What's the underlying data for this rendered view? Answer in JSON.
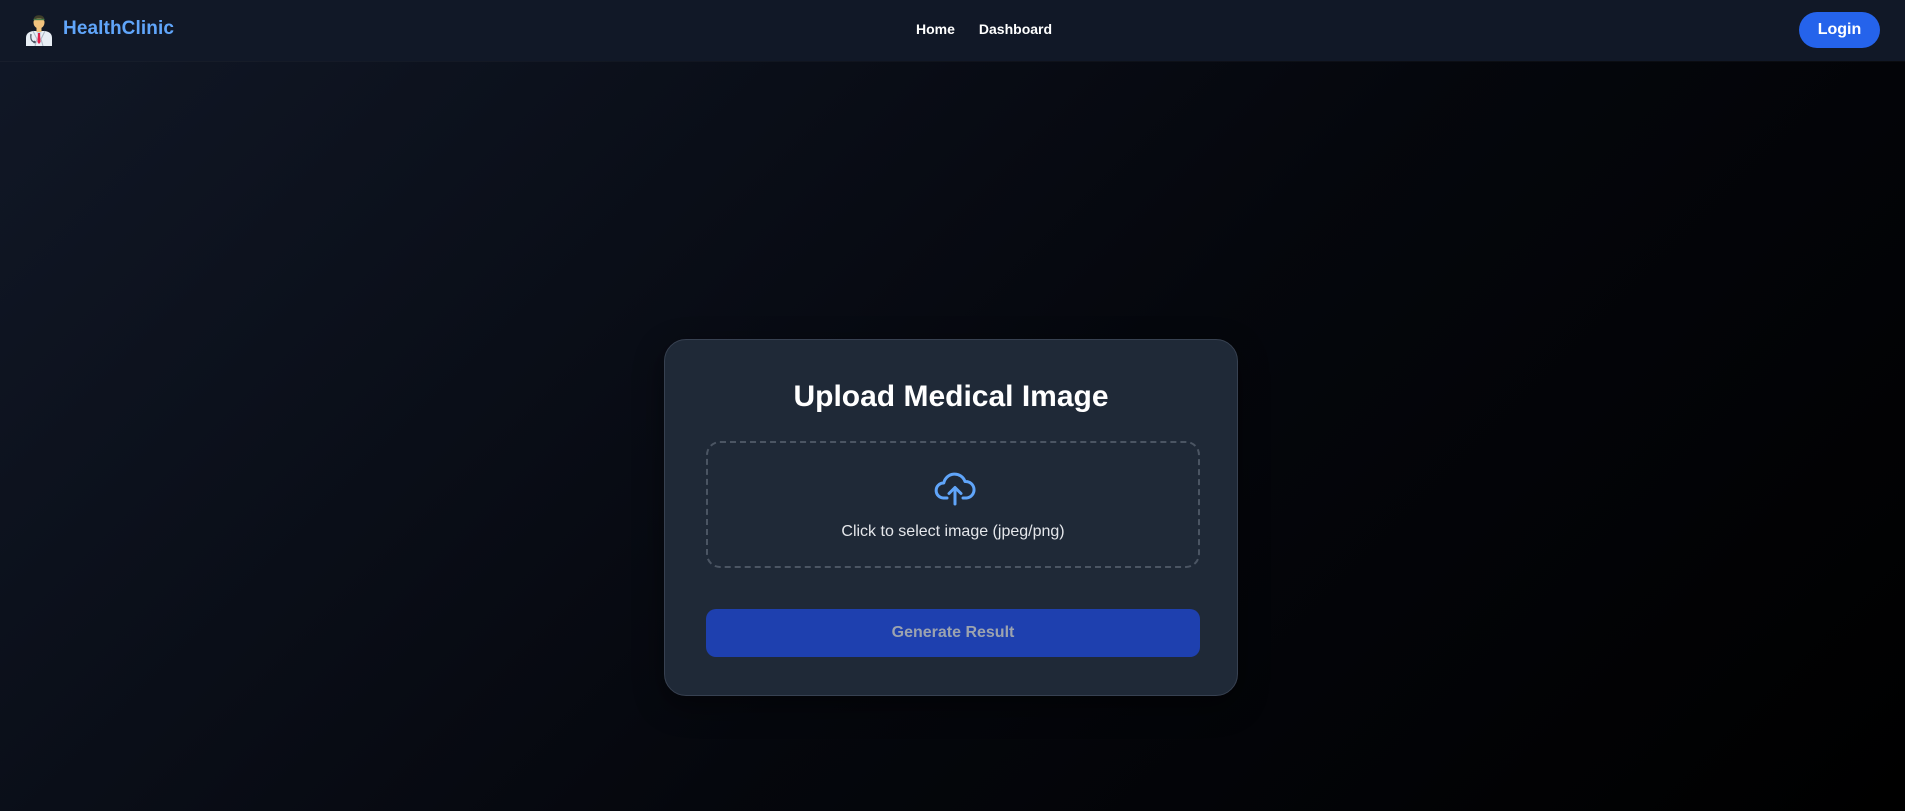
{
  "brand": {
    "name": "HealthClinic",
    "logo_icon": "doctor-avatar-icon",
    "color": "#60a5fa"
  },
  "nav": {
    "links": [
      {
        "label": "Home"
      },
      {
        "label": "Dashboard"
      }
    ],
    "login_label": "Login"
  },
  "upload_card": {
    "title": "Upload Medical Image",
    "dropzone_icon": "cloud-upload-icon",
    "dropzone_text": "Click to select image (jpeg/png)",
    "generate_label": "Generate Result",
    "generate_disabled": true
  },
  "colors": {
    "accent": "#2563eb",
    "card_bg": "#1f2937",
    "navbar_bg": "#111827",
    "button_disabled_bg": "#1e40af"
  }
}
